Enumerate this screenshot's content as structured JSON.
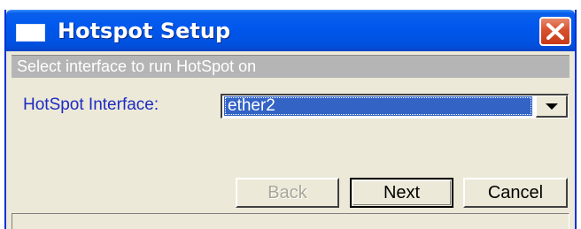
{
  "window": {
    "title": "Hotspot Setup",
    "title_icon": "window-icon",
    "close_icon": "close-icon"
  },
  "subtitle": "Select interface to run HotSpot on",
  "form": {
    "interface_label": "HotSpot Interface:",
    "interface_value": "ether2",
    "dropdown_icon": "chevron-down-icon"
  },
  "buttons": {
    "back": "Back",
    "next": "Next",
    "cancel": "Cancel"
  },
  "colors": {
    "titlebar": "#0058ee",
    "label_text": "#1d2bc4",
    "selection": "#3263c5",
    "dialog_bg": "#ece9d8",
    "close_button": "#d8512d"
  }
}
